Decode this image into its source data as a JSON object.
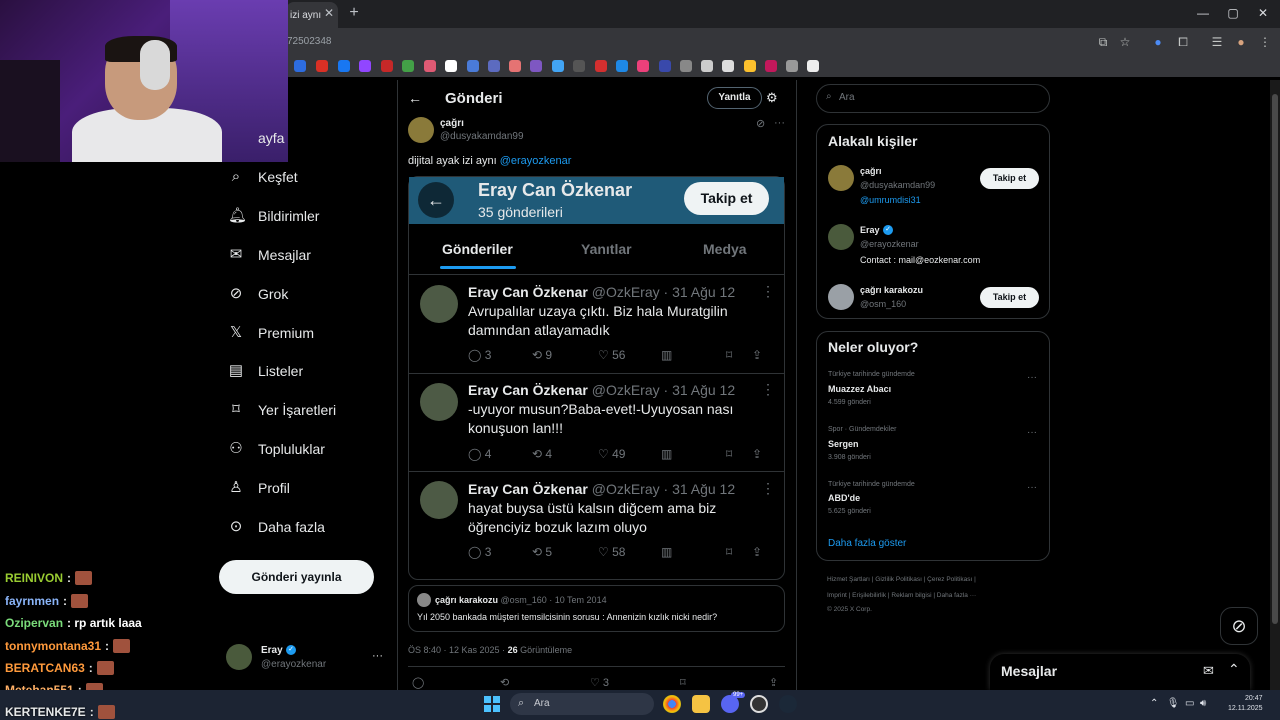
{
  "browser": {
    "tab_label": "izi aynı",
    "url_fragment": "72502348",
    "new_tab_icon": "plus-icon",
    "window_controls": [
      "—",
      "▢",
      "✕"
    ]
  },
  "left_nav": {
    "items": [
      {
        "label": "ayfa",
        "icon": "home-icon"
      },
      {
        "label": "Keşfet",
        "icon": "search-icon"
      },
      {
        "label": "Bildirimler",
        "icon": "bell-icon"
      },
      {
        "label": "Mesajlar",
        "icon": "mail-icon"
      },
      {
        "label": "Grok",
        "icon": "grok-icon"
      },
      {
        "label": "Premium",
        "icon": "x-logo-icon"
      },
      {
        "label": "Listeler",
        "icon": "list-icon"
      },
      {
        "label": "Yer İşaretleri",
        "icon": "bookmark-icon"
      },
      {
        "label": "Topluluklar",
        "icon": "people-icon"
      },
      {
        "label": "Profil",
        "icon": "person-icon"
      },
      {
        "label": "Daha fazla",
        "icon": "more-circle-icon"
      }
    ],
    "post_button": "Gönderi yayınla",
    "account": {
      "name": "Eray",
      "handle": "@erayozkenar",
      "more": "···"
    }
  },
  "chat": [
    {
      "user": "REINIVON",
      "color": "#9acd32"
    },
    {
      "user": "fayrnmen",
      "color": "#8ab4f8"
    },
    {
      "user": "Ozipervan",
      "color": "#7bdc7b",
      "message": ": rp artık laaa"
    },
    {
      "user": "tonnymontana31",
      "color": "#ff9a3c"
    },
    {
      "user": "BERATCAN63",
      "color": "#ff9a3c"
    },
    {
      "user": "Metehan551",
      "color": "#ffb066"
    },
    {
      "user": "KERTENKE7E",
      "color": "#e7e9ea"
    }
  ],
  "main": {
    "back": "←",
    "title": "Gönderi",
    "reply_pill": "Yanıtla",
    "post": {
      "name": "çağrı",
      "handle": "@dusyakamdan99",
      "text": "dijital ayak izi aynı ",
      "mention": "@erayozkenar",
      "more": "···"
    },
    "screenshot": {
      "profile_name": "Eray Can Özkenar",
      "post_count": "35 gönderileri",
      "follow": "Takip et",
      "tabs": [
        "Gönderiler",
        "Yanıtlar",
        "Medya"
      ],
      "posts": [
        {
          "name": "Eray Can Özkenar",
          "meta": "@OzkEray · 31 Ağu 12",
          "text": "Avrupalılar uzaya çıktı. Biz hala Muratgilin damından atlayamadık",
          "replies": "3",
          "reposts": "9",
          "likes": "56"
        },
        {
          "name": "Eray Can Özkenar",
          "meta": "@OzkEray · 31 Ağu 12",
          "text": "-uyuyor musun?Baba-evet!-Uyuyosan nası konuşuon lan!!!",
          "replies": "4",
          "reposts": "4",
          "likes": "49"
        },
        {
          "name": "Eray Can Özkenar",
          "meta": "@OzkEray · 31 Ağu 12",
          "text": "hayat buysa üstü kalsın diğcem ama biz öğrenciyiz bozuk lazım oluyo",
          "replies": "3",
          "reposts": "5",
          "likes": "58"
        }
      ]
    },
    "quote": {
      "name": "çağrı karakozu",
      "meta": "@osm_160 · 10 Tem 2014",
      "text": "Yıl 2050 bankada müşteri temsilcisinin sorusu : Annenizin kızlık nicki nedir?"
    },
    "meta": {
      "time": "ÖS 8:40 · 12 Kas 2025 · ",
      "views": "26",
      "views_label": " Görüntüleme"
    },
    "bottom_like": "3"
  },
  "right": {
    "search_placeholder": "Ara",
    "related_title": "Alakalı kişiler",
    "people": [
      {
        "name": "çağrı",
        "handle": "@dusyakamdan99",
        "bio": "@umrumdisi31",
        "follow": "Takip et"
      },
      {
        "name": "Eray",
        "handle": "@erayozkenar",
        "bio": "Contact : mail@eozkenar.com",
        "verified": true
      },
      {
        "name": "çağrı karakozu",
        "handle": "@osm_160",
        "follow": "Takip et"
      }
    ],
    "trends_title": "Neler oluyor?",
    "trends": [
      {
        "context": "Türkiye tarihinde gündemde",
        "title": "Muazzez Abacı",
        "count": "4.599 gönderi"
      },
      {
        "context": "Spor · Gündemdekiler",
        "title": "Sergen",
        "count": "3.908 gönderi"
      },
      {
        "context": "Türkiye tarihinde gündemde",
        "title": "ABD'de",
        "count": "5.625 gönderi"
      }
    ],
    "show_more": "Daha fazla göster",
    "footer": {
      "line1": "Hizmet Şartları  |  Gizlilik Politikası  |  Çerez Politikası  |",
      "line2": "Imprint  |  Erişilebilirlik  |  Reklam bilgisi  |  Daha fazla ···",
      "line3": "© 2025 X Corp."
    },
    "messages_dock": "Mesajlar"
  },
  "taskbar": {
    "search": "Ara",
    "time": "20:47",
    "date": "12.11.2025",
    "badge": "99+"
  },
  "colors": {
    "accent": "#1d9bf0",
    "verified": "#1d9bf0",
    "background": "#000000"
  }
}
